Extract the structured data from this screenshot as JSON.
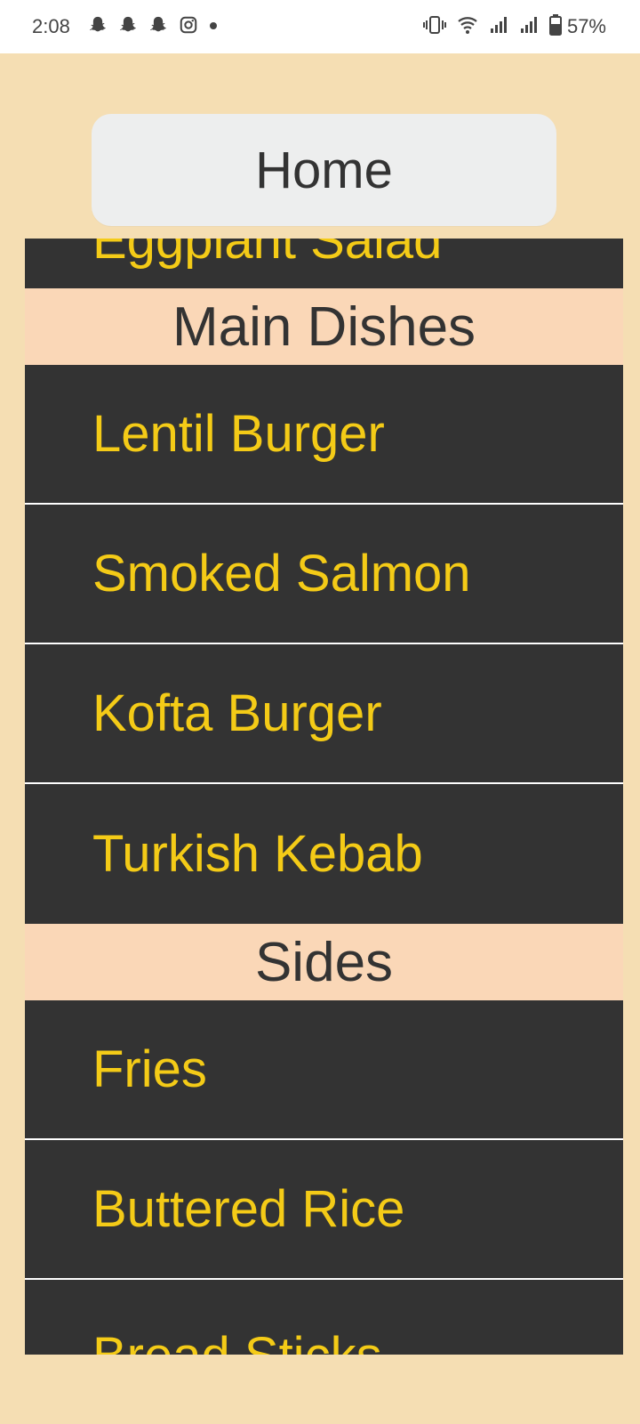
{
  "status_bar": {
    "time": "2:08",
    "battery_percent": "57%",
    "left_icons": [
      "snapchat-icon",
      "snapchat-icon",
      "snapchat-icon",
      "instagram-icon",
      "dot-icon"
    ],
    "right_icons": [
      "vibrate-icon",
      "wifi-icon",
      "signal-icon",
      "signal-icon",
      "battery-icon"
    ]
  },
  "header": {
    "home_label": "Home"
  },
  "menu": {
    "partial_top_item": "Eggplant Salad",
    "sections": [
      {
        "title": "Main Dishes",
        "items": [
          "Lentil Burger",
          "Smoked Salmon",
          "Kofta Burger",
          "Turkish Kebab"
        ]
      },
      {
        "title": "Sides",
        "items": [
          "Fries",
          "Buttered Rice",
          "Bread Sticks"
        ]
      }
    ]
  },
  "colors": {
    "background": "#F5DEB3",
    "item_background": "#333333",
    "item_text": "#F4CB17",
    "section_background": "#FAD7B7",
    "home_button_background": "#EDEEEE"
  }
}
